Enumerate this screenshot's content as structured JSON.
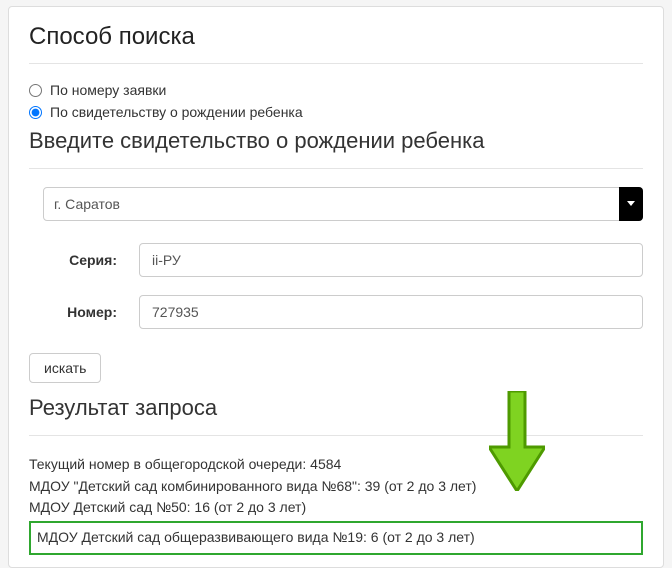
{
  "headings": {
    "search_method": "Способ поиска",
    "enter_certificate": "Введите свидетельство о рождении ребенка",
    "result": "Результат запроса"
  },
  "radios": {
    "by_app_number": "По номеру заявки",
    "by_birth_cert": "По свидетельству о рождении ребенка"
  },
  "city_select": {
    "value": "г. Саратов"
  },
  "fields": {
    "series_label": "Серия:",
    "series_value": "ii-РУ",
    "number_label": "Номер:",
    "number_value": "727935"
  },
  "buttons": {
    "search": "искать"
  },
  "results": {
    "line1": "Текущий номер в общегородской очереди: 4584",
    "line2": "МДОУ \"Детский сад комбинированного вида №68\": 39 (от 2 до 3 лет)",
    "line3": "МДОУ Детский сад №50: 16 (от 2 до 3 лет)",
    "line4": "МДОУ Детский сад общеразвивающего вида №19: 6 (от 2 до 3 лет)"
  }
}
